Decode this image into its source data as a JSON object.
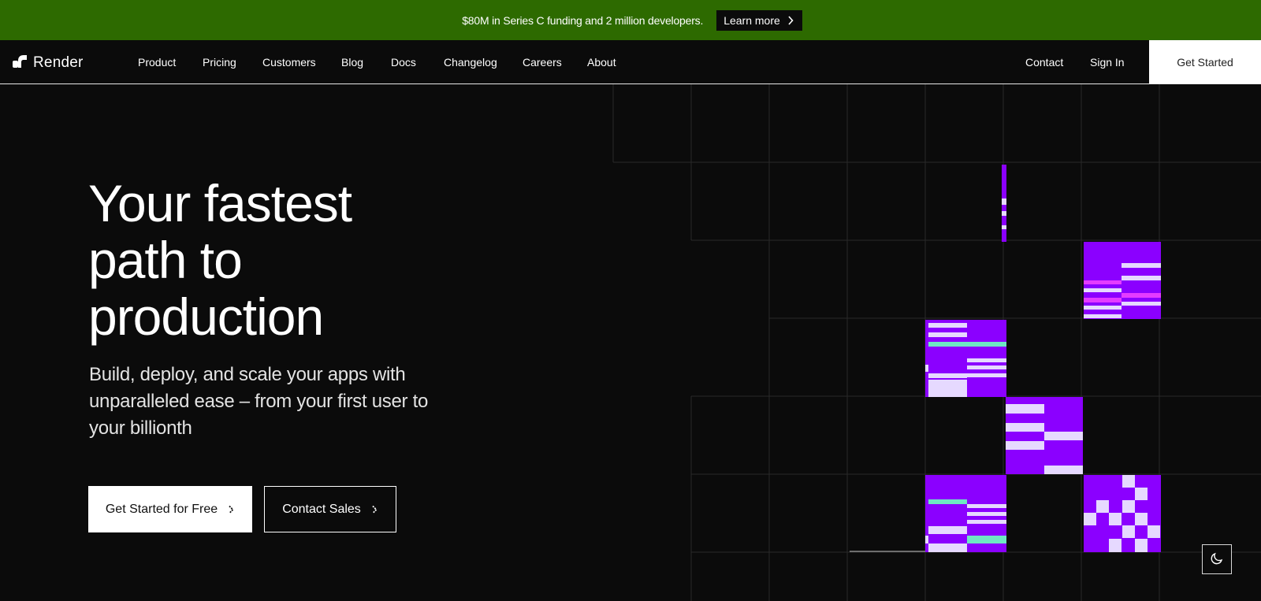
{
  "banner": {
    "text": "$80M in Series C funding and 2 million developers.",
    "button_label": "Learn more",
    "background": "#2d6a00"
  },
  "nav": {
    "logo_text": "Render",
    "items": [
      "Product",
      "Pricing",
      "Customers",
      "Blog",
      "Docs",
      "Changelog",
      "Careers",
      "About"
    ],
    "contact": "Contact",
    "sign_in": "Sign In",
    "get_started": "Get Started"
  },
  "hero": {
    "title_lines": [
      "Your fastest",
      "path to",
      "production"
    ],
    "subtitle": "Build, deploy, and scale your apps with unparalleled ease – from your first user to your billionth",
    "primary_cta": "Get Started for Free",
    "secondary_cta": "Contact Sales"
  },
  "colors": {
    "accent_purple": "#8b00ff",
    "accent_magenta": "#e43cff",
    "accent_mint": "#6ee7c3",
    "background": "#0b0b0b"
  },
  "icons": {
    "logo": "render-logo-icon",
    "chevron": "chevron-right-icon",
    "theme": "moon-icon"
  }
}
